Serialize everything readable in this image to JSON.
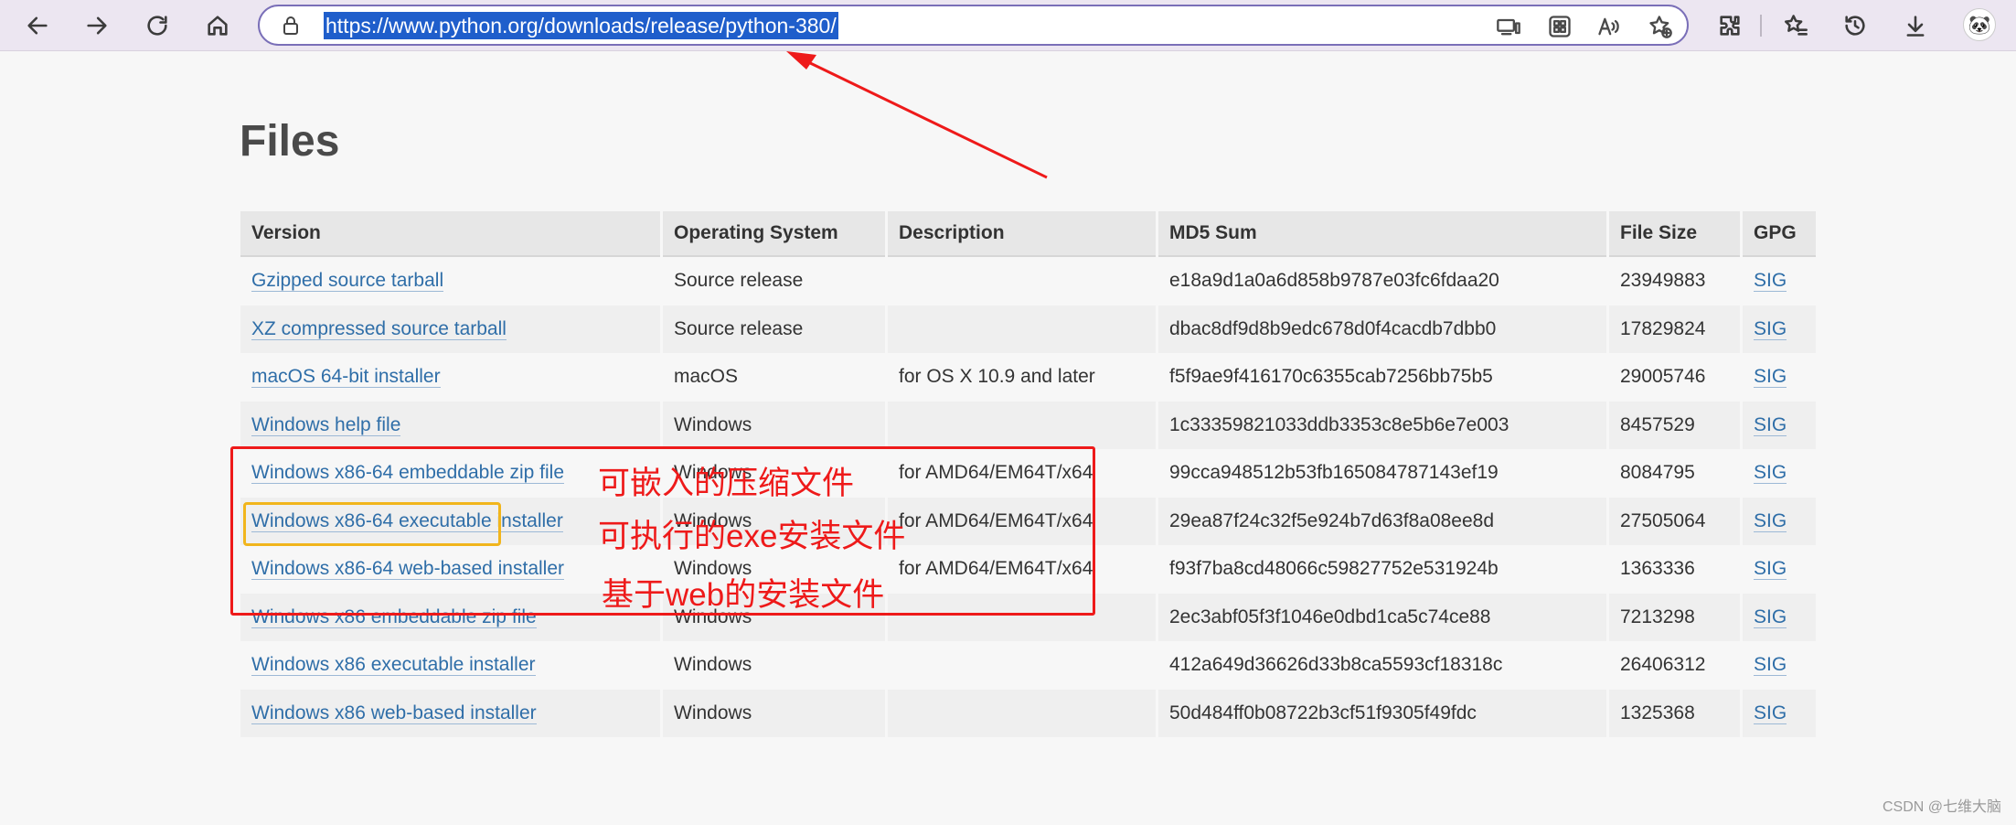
{
  "browser": {
    "url": "https://www.python.org/downloads/release/python-380/",
    "icons": [
      "back-icon",
      "forward-icon",
      "refresh-icon",
      "home-icon",
      "lock-icon",
      "device-icon",
      "app-grid-icon",
      "read-aloud-icon",
      "add-favorite-icon",
      "extensions-icon",
      "favorites-icon",
      "history-icon",
      "downloads-icon",
      "profile-avatar"
    ]
  },
  "page": {
    "title": "Files"
  },
  "table": {
    "headers": [
      "Version",
      "Operating System",
      "Description",
      "MD5 Sum",
      "File Size",
      "GPG"
    ],
    "rows": [
      {
        "version": "Gzipped source tarball",
        "os": "Source release",
        "desc": "",
        "md5": "e18a9d1a0a6d858b9787e03fc6fdaa20",
        "size": "23949883",
        "gpg": "SIG"
      },
      {
        "version": "XZ compressed source tarball",
        "os": "Source release",
        "desc": "",
        "md5": "dbac8df9d8b9edc678d0f4cacdb7dbb0",
        "size": "17829824",
        "gpg": "SIG"
      },
      {
        "version": "macOS 64-bit installer",
        "os": "macOS",
        "desc": "for OS X 10.9 and later",
        "md5": "f5f9ae9f416170c6355cab7256bb75b5",
        "size": "29005746",
        "gpg": "SIG"
      },
      {
        "version": "Windows help file",
        "os": "Windows",
        "desc": "",
        "md5": "1c33359821033ddb3353c8e5b6e7e003",
        "size": "8457529",
        "gpg": "SIG"
      },
      {
        "version": "Windows x86-64 embeddable zip file",
        "os": "Windows",
        "desc": "for AMD64/EM64T/x64",
        "md5": "99cca948512b53fb165084787143ef19",
        "size": "8084795",
        "gpg": "SIG"
      },
      {
        "version": "Windows x86-64 executable installer",
        "os": "Windows",
        "desc": "for AMD64/EM64T/x64",
        "md5": "29ea87f24c32f5e924b7d63f8a08ee8d",
        "size": "27505064",
        "gpg": "SIG"
      },
      {
        "version": "Windows x86-64 web-based installer",
        "os": "Windows",
        "desc": "for AMD64/EM64T/x64",
        "md5": "f93f7ba8cd48066c59827752e531924b",
        "size": "1363336",
        "gpg": "SIG"
      },
      {
        "version": "Windows x86 embeddable zip file",
        "os": "Windows",
        "desc": "",
        "md5": "2ec3abf05f3f1046e0dbd1ca5c74ce88",
        "size": "7213298",
        "gpg": "SIG"
      },
      {
        "version": "Windows x86 executable installer",
        "os": "Windows",
        "desc": "",
        "md5": "412a649d36626d33b8ca5593cf18318c",
        "size": "26406312",
        "gpg": "SIG"
      },
      {
        "version": "Windows x86 web-based installer",
        "os": "Windows",
        "desc": "",
        "md5": "50d484ff0b08722b3cf51f9305f49fdc",
        "size": "1325368",
        "gpg": "SIG"
      }
    ]
  },
  "annotations": {
    "embeddable": "可嵌入的压缩文件",
    "executable": "可执行的exe安装文件",
    "web_based": "基于web的安装文件",
    "colors": {
      "red": "#ee1a1a",
      "yellow": "#f1b51c"
    }
  },
  "watermark": "CSDN @七维大脑"
}
